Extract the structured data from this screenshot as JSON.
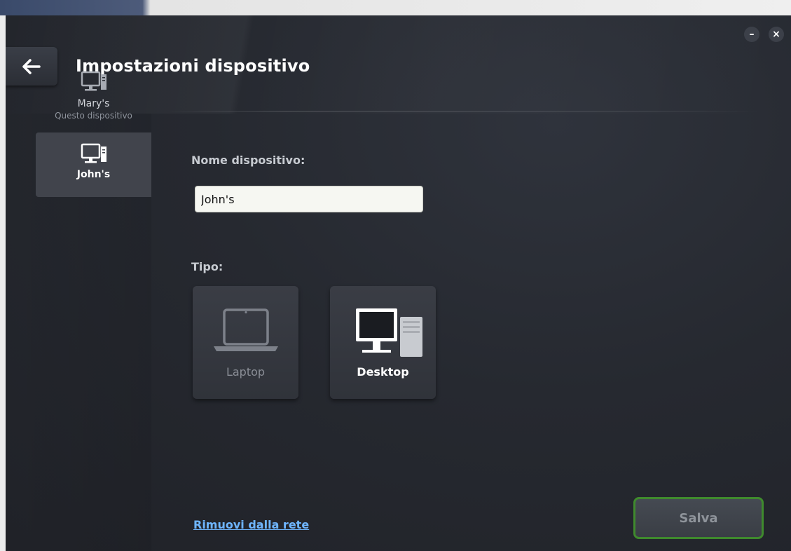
{
  "header": {
    "title": "Impostazioni dispositivo",
    "back_icon": "arrow-left-icon",
    "minimize_icon": "minimize-icon",
    "close_icon": "close-icon",
    "minimize_glyph": "–",
    "close_glyph": "×"
  },
  "sidebar": {
    "items": [
      {
        "name": "Mary's",
        "subtitle": "Questo dispositivo",
        "icon": "desktop-computer-icon",
        "selected": false
      },
      {
        "name": "John's",
        "subtitle": "",
        "icon": "desktop-computer-icon",
        "selected": true
      }
    ]
  },
  "form": {
    "name_label": "Nome dispositivo:",
    "name_value": "John's",
    "type_label": "Tipo:",
    "types": [
      {
        "label": "Laptop",
        "icon": "laptop-icon",
        "selected": false
      },
      {
        "label": "Desktop",
        "icon": "desktop-computer-icon",
        "selected": true
      }
    ]
  },
  "footer": {
    "remove_link": "Rimuovi dalla rete",
    "save_label": "Salva"
  },
  "colors": {
    "background": "#262930",
    "accent_border": "#3f8a2d",
    "link": "#6fb6ff"
  }
}
